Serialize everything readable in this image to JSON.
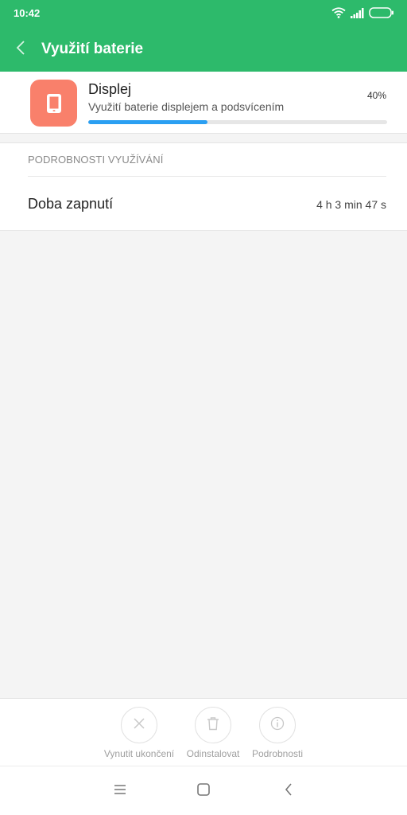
{
  "status_bar": {
    "time": "10:42",
    "icons": [
      "wifi-icon",
      "signal-icon",
      "battery-icon"
    ]
  },
  "app_bar": {
    "title": "Využití baterie",
    "back_icon": "chevron-left-icon"
  },
  "app_card": {
    "icon": "tablet-icon",
    "icon_color": "#f9806b",
    "name": "Displej",
    "description": "Využití baterie displejem a podsvícením",
    "percent_label": "40%",
    "usage_fraction": 0.4,
    "progress_color": "#2a9ff2"
  },
  "details": {
    "header": "PODROBNOSTI VYUŽÍVÁNÍ",
    "rows": [
      {
        "label": "Doba zapnutí",
        "value": "4 h 3 min 47 s"
      }
    ]
  },
  "actions": [
    {
      "icon": "close-icon",
      "label": "Vynutit ukončení"
    },
    {
      "icon": "trash-icon",
      "label": "Odinstalovat"
    },
    {
      "icon": "info-icon",
      "label": "Podrobnosti"
    }
  ],
  "nav_bar": {
    "icons": [
      "menu-icon",
      "home-icon",
      "back-icon"
    ]
  },
  "colors": {
    "accent": "#2dba6b",
    "background": "#f4f4f4"
  }
}
